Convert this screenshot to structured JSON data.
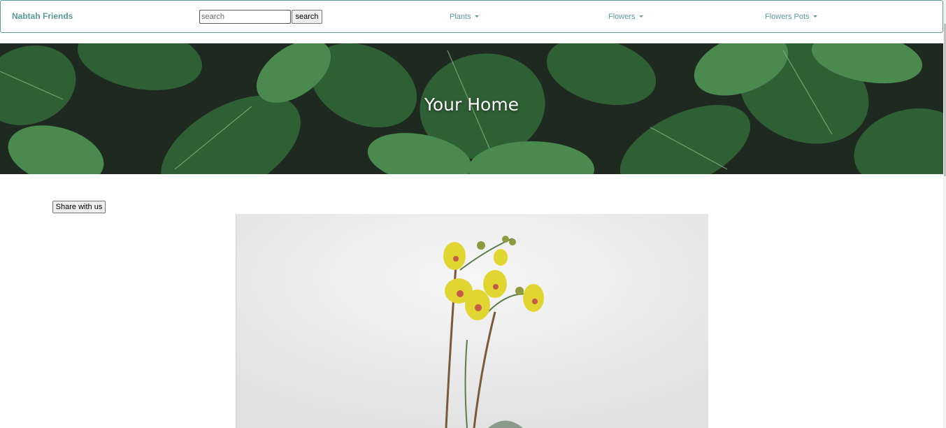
{
  "navbar": {
    "brand": "Nabtah Friends",
    "search": {
      "placeholder": "search",
      "value": "",
      "button_label": "search"
    },
    "menus": [
      {
        "label": "Plants"
      },
      {
        "label": "Flowers"
      },
      {
        "label": "Flowers Pots"
      }
    ]
  },
  "hero": {
    "title": "Your Home"
  },
  "main": {
    "share_label": "Share with us"
  },
  "colors": {
    "accent": "#5a9a96",
    "hero_dark": "#1f2a22",
    "leaf": "#3f7a45",
    "orchid": "#e1d631"
  },
  "icons": {
    "dropdown": "caret-down-icon"
  }
}
